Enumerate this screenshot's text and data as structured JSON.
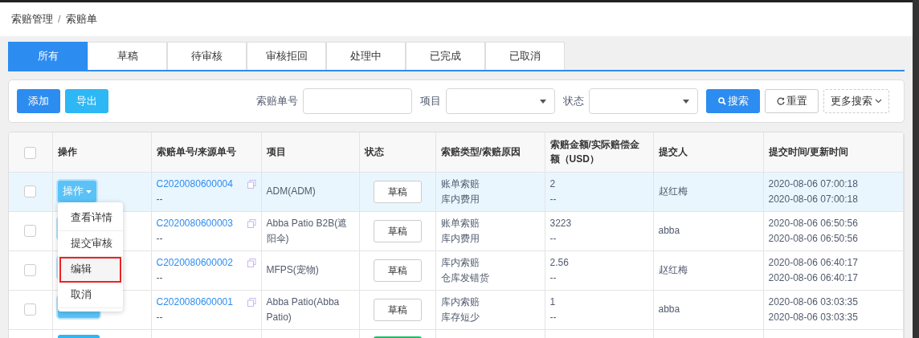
{
  "breadcrumb": [
    "索赔管理",
    "索赔单"
  ],
  "breadcrumb_separator": "/",
  "tabs": [
    {
      "label": "所有",
      "selected": true
    },
    {
      "label": "草稿",
      "selected": false
    },
    {
      "label": "待审核",
      "selected": false
    },
    {
      "label": "审核拒回",
      "selected": false
    },
    {
      "label": "处理中",
      "selected": false
    },
    {
      "label": "已完成",
      "selected": false
    },
    {
      "label": "已取消",
      "selected": false
    }
  ],
  "toolbar": {
    "buttons": [
      {
        "label": "添加",
        "kind": "primary"
      },
      {
        "label": "导出",
        "kind": "info"
      }
    ],
    "filters": [
      {
        "label": "索赔单号",
        "kind": "text"
      },
      {
        "label": "项目",
        "kind": "select"
      },
      {
        "label": "状态",
        "kind": "select"
      }
    ],
    "search_button": "搜索",
    "reset_button": "重置",
    "more_button": "更多搜索"
  },
  "table": {
    "all_checked": false,
    "columns": [
      "操作",
      "索赔单号/来源单号",
      "项目",
      "状态",
      "索赔类型/索赔原因",
      "索赔金额/实际赔偿金额（USD）",
      "提交人",
      "提交时间/更新时间"
    ],
    "rows": [
      {
        "selected": true,
        "checked": false,
        "menu_open": true,
        "action": "操作",
        "claim_no": "C2020080600004",
        "source_no": "--",
        "project": "ADM(ADM)",
        "status": "草稿",
        "claim_type": "账单索赔",
        "reason": "库内费用",
        "amount": "2",
        "actual": "--",
        "submitter": "赵红梅",
        "submitted": "2020-08-06 07:00:18",
        "updated": "2020-08-06 07:00:18"
      },
      {
        "selected": false,
        "checked": false,
        "claim_no": "C2020080600003",
        "source_no": "--",
        "project": "Abba Patio B2B(遮阳伞)",
        "status": "草稿",
        "claim_type": "账单索赔",
        "reason": "库内费用",
        "amount": "3223",
        "actual": "--",
        "submitter": "abba",
        "submitted": "2020-08-06 06:50:56",
        "updated": "2020-08-06 06:50:56"
      },
      {
        "selected": false,
        "checked": false,
        "claim_no": "C2020080600002",
        "source_no": "--",
        "project": "MFPS(宠物)",
        "status": "草稿",
        "claim_type": "库内索赔",
        "reason": "仓库发错货",
        "amount": "2.56",
        "actual": "--",
        "submitter": "赵红梅",
        "submitted": "2020-08-06 06:40:17",
        "updated": "2020-08-06 06:40:17"
      },
      {
        "selected": false,
        "checked": false,
        "claim_no": "C2020080600001",
        "source_no": "--",
        "project": "Abba Patio(Abba Patio)",
        "status": "草稿",
        "claim_type": "库内索赔",
        "reason": "库存短少",
        "amount": "1",
        "actual": "--",
        "submitter": "abba",
        "submitted": "2020-08-06 03:03:35",
        "updated": "2020-08-06 03:03:35"
      }
    ],
    "action_menu": {
      "items": [
        {
          "label": "查看详情",
          "highlighted": false
        },
        {
          "label": "提交审核",
          "highlighted": false
        },
        {
          "label": "编辑",
          "highlighted": true
        },
        {
          "label": "取消",
          "highlighted": false
        }
      ]
    }
  }
}
